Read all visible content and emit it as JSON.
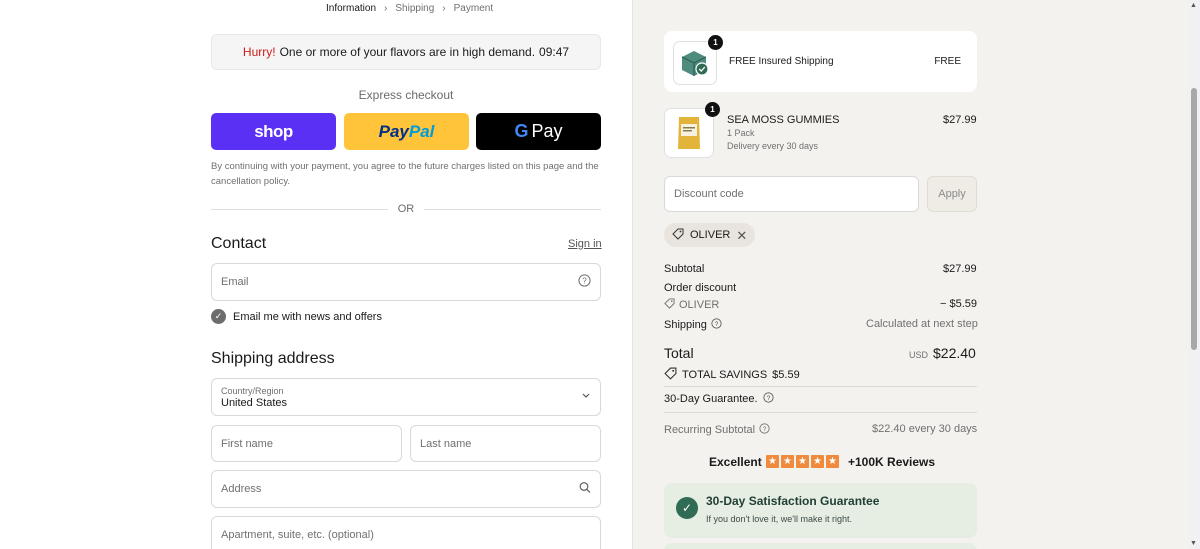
{
  "breadcrumb": {
    "items": [
      "Information",
      "Shipping",
      "Payment"
    ]
  },
  "urgency": {
    "hurry": "Hurry!",
    "message": "One or more of your flavors are in high demand.",
    "timer": "09:47"
  },
  "express": {
    "label": "Express checkout",
    "shop_label": "shop",
    "paypal_a": "Pay",
    "paypal_b": "Pal",
    "gpay_g": "G",
    "gpay_label": "Pay",
    "policy": "By continuing with your payment, you agree to the future charges listed on this page and the cancellation policy."
  },
  "or_label": "OR",
  "contact": {
    "title": "Contact",
    "signin": "Sign in",
    "email_placeholder": "Email",
    "newsletter_label": "Email me with news and offers"
  },
  "shipping": {
    "title": "Shipping address",
    "country_label": "Country/Region",
    "country_value": "United States",
    "first_name": "First name",
    "last_name": "Last name",
    "address": "Address",
    "apartment": "Apartment, suite, etc. (optional)"
  },
  "summary": {
    "shipping_item": {
      "name": "FREE Insured Shipping",
      "price": "FREE",
      "qty": "1"
    },
    "product": {
      "name": "SEA MOSS GUMMIES",
      "variant": "1 Pack",
      "delivery": "Delivery every 30 days",
      "price": "$27.99",
      "qty": "1"
    },
    "discount_placeholder": "Discount code",
    "apply_label": "Apply",
    "applied_code": "OLIVER",
    "subtotal_label": "Subtotal",
    "subtotal_value": "$27.99",
    "order_discount_label": "Order discount",
    "discount_code": "OLIVER",
    "discount_value": "− $5.59",
    "shipping_label": "Shipping",
    "shipping_value": "Calculated at next step",
    "total_label": "Total",
    "currency": "USD",
    "total_value": "$22.40",
    "savings_label": "TOTAL SAVINGS",
    "savings_value": "$5.59",
    "guarantee_label": "30-Day Guarantee.",
    "recurring_label": "Recurring Subtotal",
    "recurring_value": "$22.40 every 30 days",
    "reviews_excellent": "Excellent",
    "reviews_count": "+100K Reviews",
    "rating_stars": 5,
    "satisfaction_title": "30-Day Satisfaction Guarantee",
    "satisfaction_sub": "If you don't love it, we'll make it right."
  },
  "colors": {
    "shop": "#5a31f4",
    "paypal": "#ffc439",
    "hurry": "#d21a1a",
    "star": "#f08a3c",
    "guarantee_bg": "#e6eee4"
  }
}
